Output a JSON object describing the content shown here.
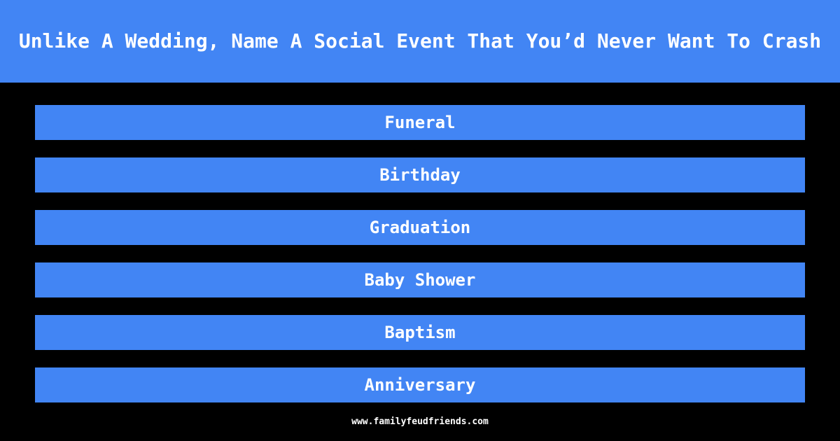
{
  "theme": {
    "background": "#000000",
    "accent": "#4285f4",
    "text": "#ffffff"
  },
  "header": {
    "question": "Unlike A Wedding, Name A Social Event That You’d Never Want To Crash"
  },
  "answers": [
    {
      "label": "Funeral"
    },
    {
      "label": "Birthday"
    },
    {
      "label": "Graduation"
    },
    {
      "label": "Baby Shower"
    },
    {
      "label": "Baptism"
    },
    {
      "label": "Anniversary"
    }
  ],
  "footer": {
    "url": "www.familyfeudfriends.com"
  }
}
